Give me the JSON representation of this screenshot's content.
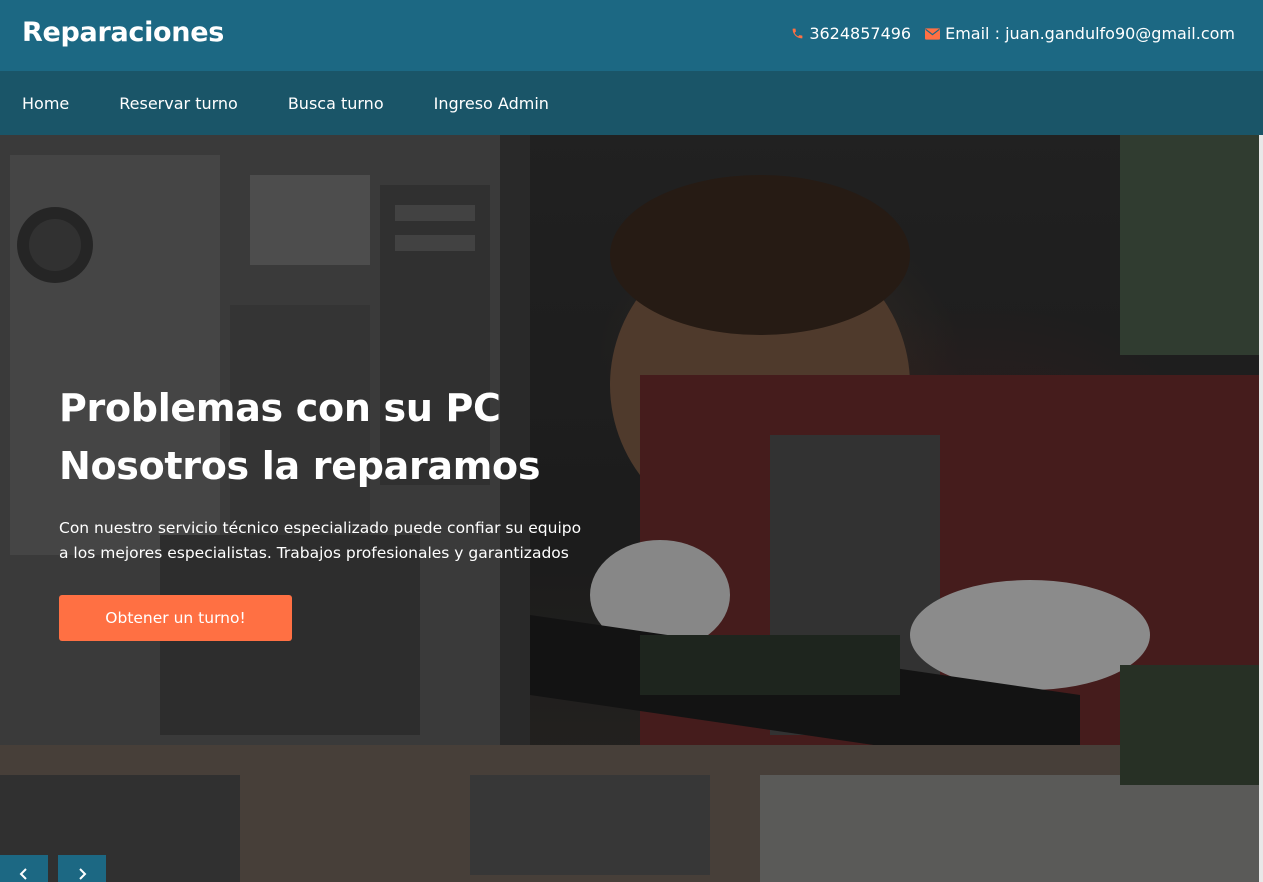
{
  "brand": "Reparaciones",
  "contact": {
    "phone": "3624857496",
    "email_label": "Email : juan.gandulfo90@gmail.com"
  },
  "nav": {
    "items": [
      "Home",
      "Reservar turno",
      "Busca turno",
      "Ingreso Admin"
    ]
  },
  "hero": {
    "headline_line1": "Problemas con su PC",
    "headline_line2": "Nosotros la reparamos",
    "description_line1": "Con nuestro servicio técnico especializado puede confiar su equipo",
    "description_line2": "a los mejores especialistas. Trabajos profesionales y garantizados",
    "cta_label": "Obtener un turno!"
  },
  "colors": {
    "topbar": "#1c6883",
    "navbar": "#1a5568",
    "accent": "#ff7043"
  },
  "icons": {
    "phone": "phone-icon",
    "email": "envelope-icon",
    "prev": "chevron-left-icon",
    "next": "chevron-right-icon"
  }
}
